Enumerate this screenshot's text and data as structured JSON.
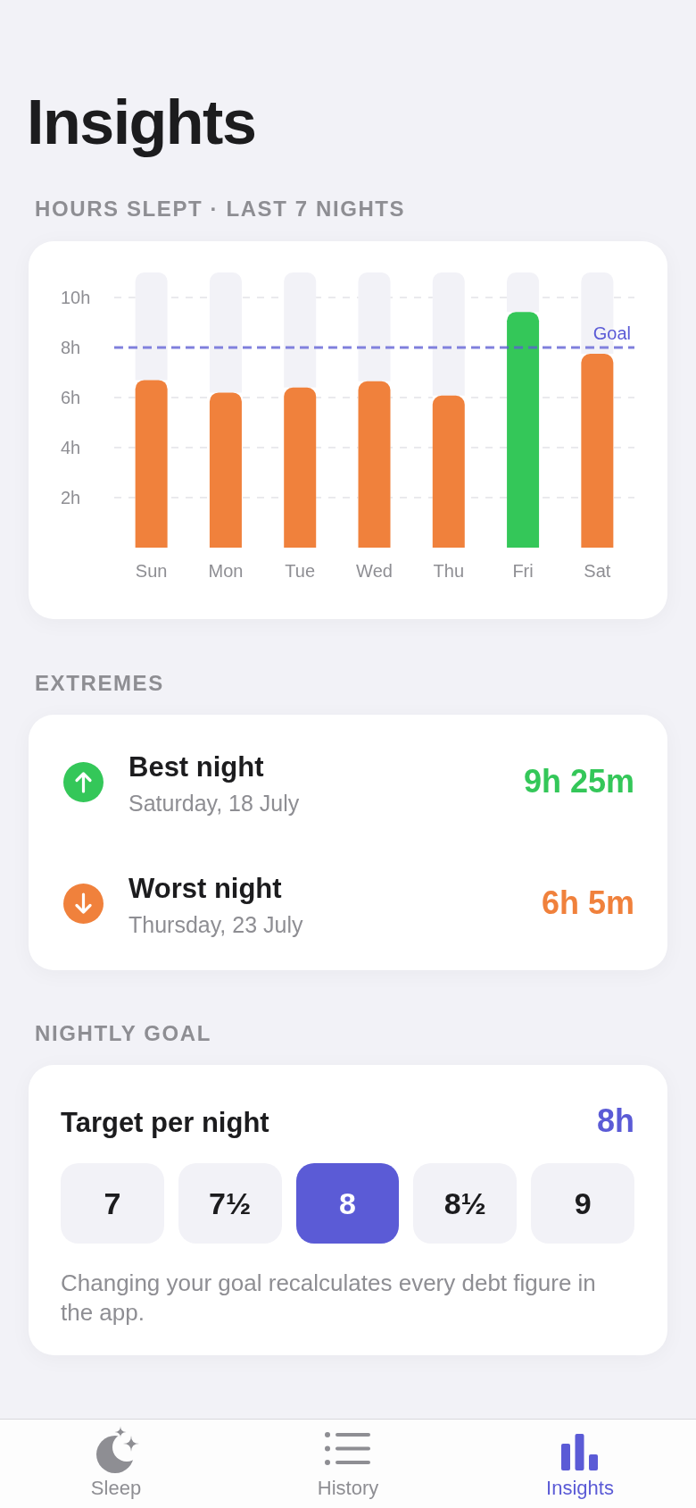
{
  "title": "Insights",
  "hours_section": {
    "title": "HOURS SLEPT · LAST 7 NIGHTS",
    "chart_data": {
      "type": "bar",
      "categories": [
        "Sun",
        "Mon",
        "Tue",
        "Wed",
        "Thu",
        "Fri",
        "Sat"
      ],
      "series": [
        {
          "color": "#f0813c",
          "values": [
            6.7,
            6.2,
            6.4,
            6.65,
            6.08,
            null,
            7.75
          ]
        },
        {
          "color": "#34c759",
          "values": [
            null,
            null,
            null,
            null,
            null,
            9.42,
            null
          ]
        }
      ],
      "stacked": true,
      "grid": true,
      "ylim": [
        0,
        10
      ],
      "yticks": [
        {
          "value": 2,
          "label": "2h"
        },
        {
          "value": 4,
          "label": "4h"
        },
        {
          "value": 6,
          "label": "6h"
        },
        {
          "value": 8,
          "label": "8h"
        },
        {
          "value": 10,
          "label": "10h"
        }
      ],
      "ref_lines": [
        {
          "axis": "y",
          "value": 8,
          "label": "Goal"
        }
      ]
    }
  },
  "extremes_section": {
    "title": "EXTREMES",
    "items": [
      {
        "kind": "best",
        "title": "Best night",
        "date": "Saturday, 18 July",
        "value": "9h 25m",
        "color": "#34c759"
      },
      {
        "kind": "worst",
        "title": "Worst night",
        "date": "Thursday, 23 July",
        "value": "6h 5m",
        "color": "#f0813c"
      }
    ]
  },
  "goal_section": {
    "title": "NIGHTLY GOAL",
    "label": "Target per night",
    "value": "8h",
    "options": [
      {
        "label": "7",
        "selected": false
      },
      {
        "label": "7½",
        "selected": false
      },
      {
        "label": "8",
        "selected": true
      },
      {
        "label": "8½",
        "selected": false
      },
      {
        "label": "9",
        "selected": false
      }
    ],
    "note": "Changing your goal recalculates every debt figure in the app."
  },
  "tab_bar": {
    "tabs": [
      {
        "label": "Sleep",
        "selected": false
      },
      {
        "label": "History",
        "selected": false
      },
      {
        "label": "Insights",
        "selected": true
      }
    ]
  }
}
